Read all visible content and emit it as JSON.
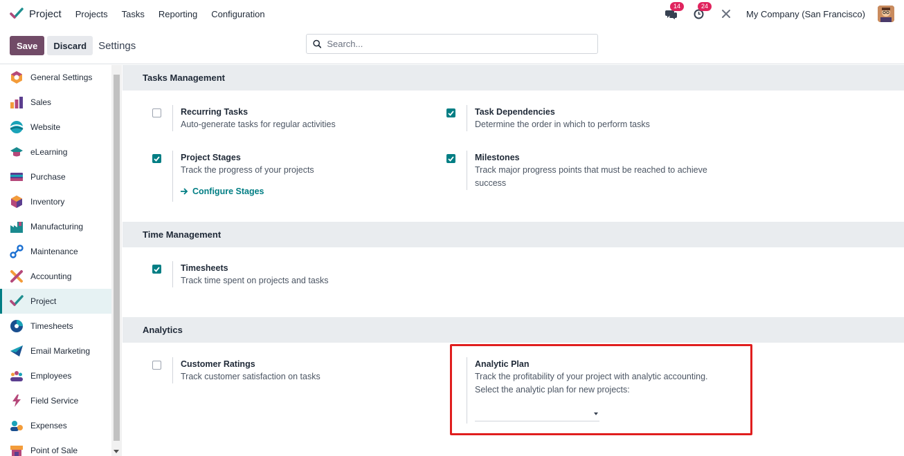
{
  "topnav": {
    "app_name": "Project",
    "menu": [
      "Projects",
      "Tasks",
      "Reporting",
      "Configuration"
    ],
    "messages_badge": "14",
    "activities_badge": "24",
    "company": "My Company (San Francisco)"
  },
  "controlbar": {
    "save_label": "Save",
    "discard_label": "Discard",
    "title": "Settings",
    "search_placeholder": "Search..."
  },
  "sidebar": {
    "items": [
      {
        "label": "General Settings",
        "icon": "general-settings-icon"
      },
      {
        "label": "Sales",
        "icon": "sales-icon"
      },
      {
        "label": "Website",
        "icon": "website-icon"
      },
      {
        "label": "eLearning",
        "icon": "elearning-icon"
      },
      {
        "label": "Purchase",
        "icon": "purchase-icon"
      },
      {
        "label": "Inventory",
        "icon": "inventory-icon"
      },
      {
        "label": "Manufacturing",
        "icon": "manufacturing-icon"
      },
      {
        "label": "Maintenance",
        "icon": "maintenance-icon"
      },
      {
        "label": "Accounting",
        "icon": "accounting-icon"
      },
      {
        "label": "Project",
        "icon": "project-icon",
        "active": true
      },
      {
        "label": "Timesheets",
        "icon": "timesheets-icon"
      },
      {
        "label": "Email Marketing",
        "icon": "email-marketing-icon"
      },
      {
        "label": "Employees",
        "icon": "employees-icon"
      },
      {
        "label": "Field Service",
        "icon": "field-service-icon"
      },
      {
        "label": "Expenses",
        "icon": "expenses-icon"
      },
      {
        "label": "Point of Sale",
        "icon": "point-of-sale-icon"
      }
    ]
  },
  "sections": {
    "tasks_management": {
      "title": "Tasks Management",
      "recurring": {
        "title": "Recurring Tasks",
        "desc": "Auto-generate tasks for regular activities",
        "checked": false
      },
      "dependencies": {
        "title": "Task Dependencies",
        "desc": "Determine the order in which to perform tasks",
        "checked": true
      },
      "stages": {
        "title": "Project Stages",
        "desc": "Track the progress of your projects",
        "checked": true,
        "link": "Configure Stages"
      },
      "milestones": {
        "title": "Milestones",
        "desc": "Track major progress points that must be reached to achieve success",
        "checked": true
      }
    },
    "time_management": {
      "title": "Time Management",
      "timesheets": {
        "title": "Timesheets",
        "desc": "Track time spent on projects and tasks",
        "checked": true
      }
    },
    "analytics": {
      "title": "Analytics",
      "ratings": {
        "title": "Customer Ratings",
        "desc": "Track customer satisfaction on tasks",
        "checked": false
      },
      "analytic_plan": {
        "title": "Analytic Plan",
        "desc": "Track the profitability of your project with analytic accounting.",
        "select_label": "Select the analytic plan for new projects:",
        "value": ""
      }
    }
  },
  "colors": {
    "accent": "#017e84",
    "primary": "#714b67",
    "highlight": "#e01e1e",
    "badge": "#e0245e"
  }
}
